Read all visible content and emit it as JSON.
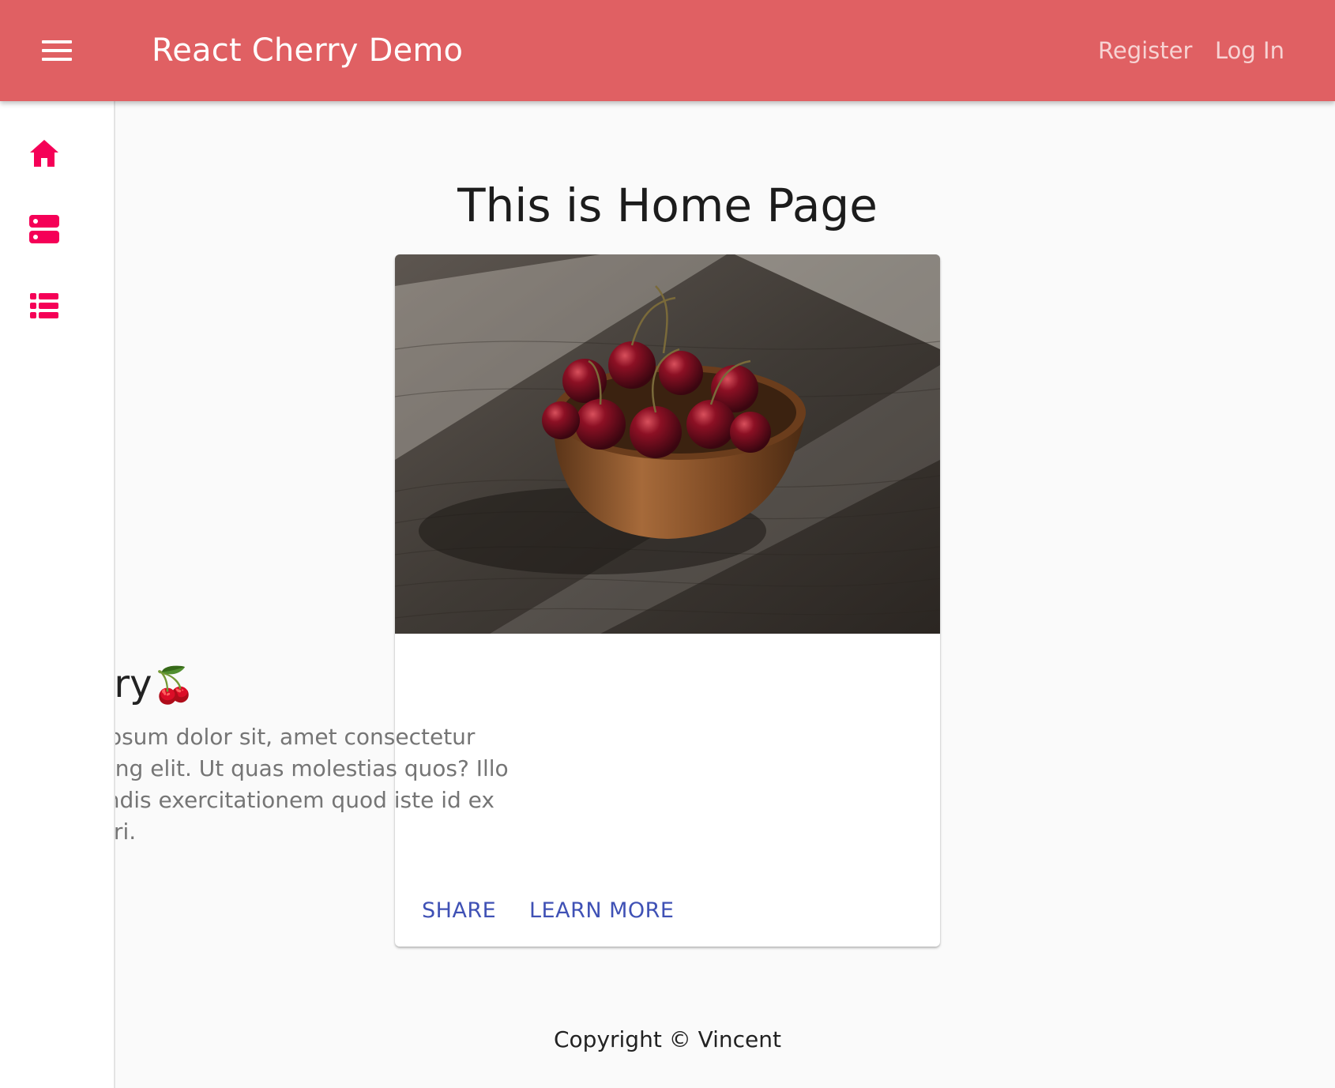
{
  "appbar": {
    "menu_icon": "hamburger-menu-icon",
    "title": "React Cherry Demo",
    "nav": {
      "register": "Register",
      "login": "Log In"
    },
    "bg_color": "#e06063"
  },
  "sidebar": {
    "accent_color": "#f50057",
    "items": [
      {
        "icon": "home-icon"
      },
      {
        "icon": "dashboard-icon"
      },
      {
        "icon": "list-icon"
      }
    ]
  },
  "main": {
    "heading": "This is Home Page",
    "card": {
      "image": "cherries-in-wooden-bowl-photo",
      "title": "Cherry",
      "title_emoji": "🍒",
      "body": "Lorem ipsum dolor sit, amet consectetur adipisicing elit. Ut quas molestias quos? Illo perferendis exercitationem quod iste id ex excepturi.",
      "actions": {
        "share": "Share",
        "learn_more": "Learn More"
      },
      "action_color": "#3f51b5"
    },
    "footer": "Copyright © Vincent"
  }
}
